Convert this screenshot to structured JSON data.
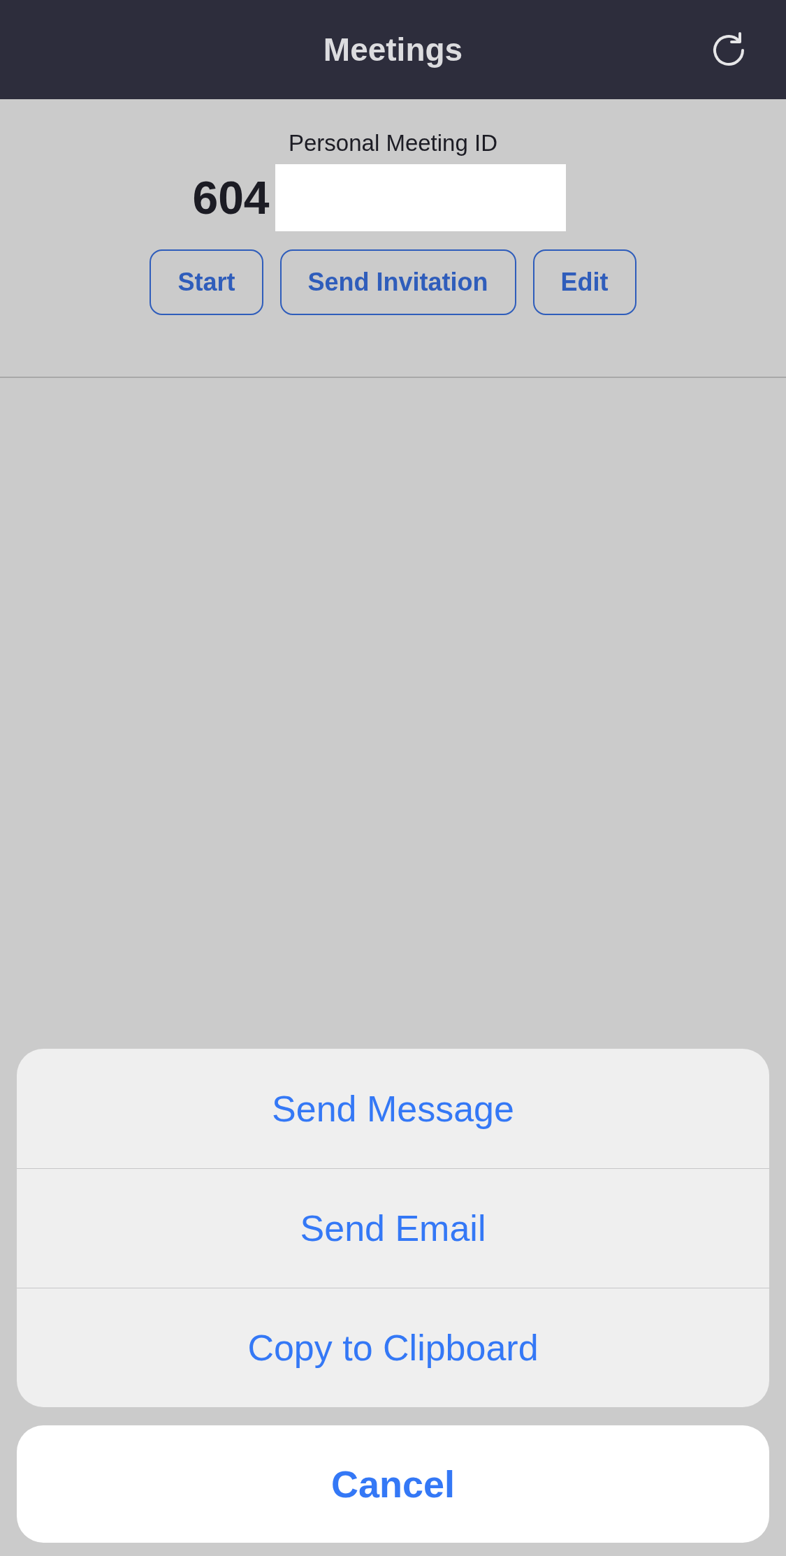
{
  "header": {
    "title": "Meetings"
  },
  "personal_meeting": {
    "label": "Personal Meeting ID",
    "id": "604"
  },
  "buttons": [
    "Start",
    "Send Invitation",
    "Edit"
  ],
  "action_sheet": {
    "actions": [
      "Send Message",
      "Send Email",
      "Copy to Clipboard"
    ],
    "cancel": "Cancel"
  }
}
